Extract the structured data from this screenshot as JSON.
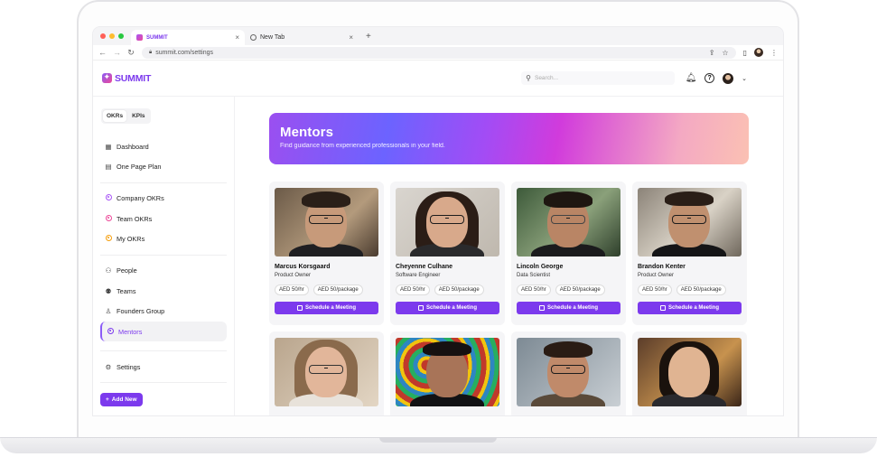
{
  "browser": {
    "tabs": [
      {
        "title": "SUMMIT",
        "active": true
      },
      {
        "title": "New Tab",
        "active": false
      }
    ],
    "url": "summit.com/settings",
    "traffic_colors": [
      "#ff5f57",
      "#febc2e",
      "#28c840"
    ]
  },
  "header": {
    "logo_text": "SUMMIT",
    "search_placeholder": "Search..."
  },
  "sidebar": {
    "toggle": [
      "OKRs",
      "KPIs"
    ],
    "groups": [
      [
        {
          "label": "Dashboard",
          "icon": "grid-icon"
        },
        {
          "label": "One Page Plan",
          "icon": "file-icon"
        }
      ],
      [
        {
          "label": "Company OKRs",
          "icon": "target-icon"
        },
        {
          "label": "Team OKRs",
          "icon": "target-icon"
        },
        {
          "label": "My OKRs",
          "icon": "target-icon"
        }
      ],
      [
        {
          "label": "People",
          "icon": "people-icon"
        },
        {
          "label": "Teams",
          "icon": "teams-icon"
        },
        {
          "label": "Founders Group",
          "icon": "user-icon"
        },
        {
          "label": "Mentors",
          "icon": "target-icon",
          "active": true
        }
      ],
      [
        {
          "label": "Settings",
          "icon": "gear-icon"
        }
      ]
    ],
    "add_button": "Add New"
  },
  "hero": {
    "title": "Mentors",
    "subtitle": "Find guidance from experienced professionals in your field."
  },
  "colors": {
    "accent": "#7c3aed"
  },
  "mentors": [
    {
      "name": "Marcus Korsgaard",
      "role": "Product Owner",
      "rate": "AED 50/hr",
      "package": "AED 50/package",
      "cta": "Schedule a Meeting"
    },
    {
      "name": "Cheyenne Culhane",
      "role": "Software Engineer",
      "rate": "AED 50/hr",
      "package": "AED 50/package",
      "cta": "Schedule a Meeting"
    },
    {
      "name": "Lincoln George",
      "role": "Data Scientist",
      "rate": "AED 50/hr",
      "package": "AED 50/package",
      "cta": "Schedule a Meeting"
    },
    {
      "name": "Brandon Kenter",
      "role": "Product Owner",
      "rate": "AED 50/hr",
      "package": "AED 50/package",
      "cta": "Schedule a Meeting"
    },
    {
      "name": "",
      "role": "",
      "rate": "",
      "package": "",
      "cta": ""
    },
    {
      "name": "",
      "role": "",
      "rate": "",
      "package": "",
      "cta": ""
    },
    {
      "name": "",
      "role": "",
      "rate": "",
      "package": "",
      "cta": ""
    },
    {
      "name": "",
      "role": "",
      "rate": "",
      "package": "",
      "cta": ""
    }
  ]
}
